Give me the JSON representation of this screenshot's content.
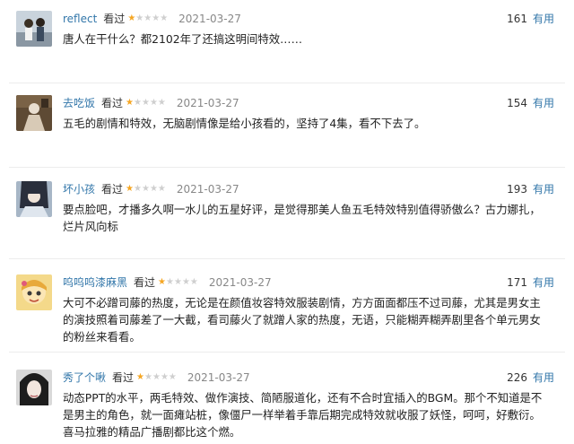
{
  "reviews": [
    {
      "user": "reflect",
      "watched": "看过",
      "rating": 1,
      "date": "2021-03-27",
      "votes": "161",
      "useful": "有用",
      "content": "唐人在干什么？都2102年了还搞这明间特效……",
      "avatar": "avatar-couple-drama-still"
    },
    {
      "user": "去吃饭",
      "watched": "看过",
      "rating": 1,
      "date": "2021-03-27",
      "votes": "154",
      "useful": "有用",
      "content": "五毛的剧情和特效，无脑剧情像是给小孩看的，坚持了4集，看不下去了。",
      "avatar": "avatar-sepia-costume"
    },
    {
      "user": "坏小孩",
      "watched": "看过",
      "rating": 1,
      "date": "2021-03-27",
      "votes": "193",
      "useful": "有用",
      "content": "要点脸吧，才播多久啊一水儿的五星好评，是觉得那美人鱼五毛特效特别值得骄傲么？古力娜扎，烂片风向标",
      "avatar": "avatar-anime-character"
    },
    {
      "user": "呜呜呜漆麻黑",
      "watched": "看过",
      "rating": 1,
      "date": "2021-03-27",
      "votes": "171",
      "useful": "有用",
      "content": "大可不必蹭司藤的热度，无论是在颜值妆容特效服装剧情，方方面面都压不过司藤，尤其是男女主的演技照着司藤差了一大截，看司藤火了就蹭人家的热度，无语，只能糊弄糊弄剧里各个单元男女的粉丝来看看。",
      "avatar": "avatar-cartoon-girl"
    },
    {
      "user": "秀了个啾",
      "watched": "看过",
      "rating": 1,
      "date": "2021-03-27",
      "votes": "226",
      "useful": "有用",
      "content": "动态PPT的水平，两毛特效、做作演技、简陋服道化，还有不合时宜插入的BGM。那个不知道是不是男主的角色，就一面瘫站桩，像僵尸一样举着手靠后期完成特效就收服了妖怪，呵呵，好敷衍。喜马拉雅的精品广播剧都比这个燃。",
      "avatar": "avatar-dark-hair-portrait"
    }
  ],
  "colors": {
    "username": "#3377aa",
    "star_filled": "#f5a623",
    "star_empty": "#cfcfcf",
    "date": "#888888"
  }
}
